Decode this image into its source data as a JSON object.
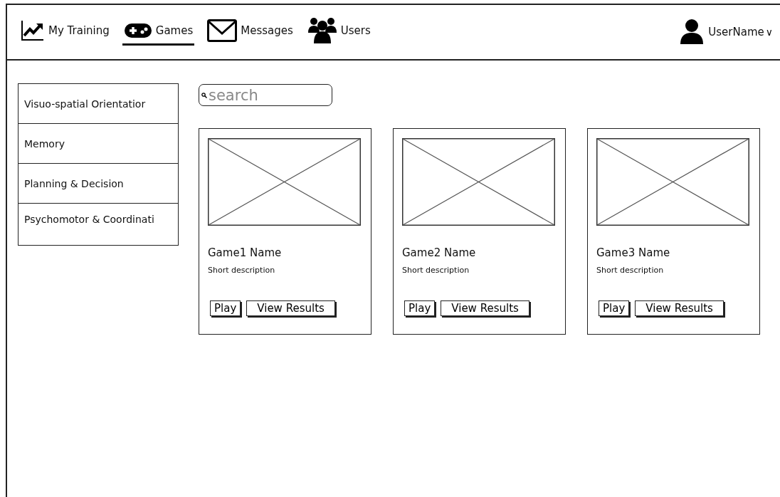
{
  "nav": [
    {
      "label": "My Training",
      "selected": false
    },
    {
      "label": "Games",
      "selected": true
    },
    {
      "label": "Messages",
      "selected": false
    },
    {
      "label": "Users",
      "selected": false
    }
  ],
  "user": {
    "name": "UserName",
    "caret": "∨"
  },
  "sidebar": {
    "items": [
      {
        "label": "Visuo-spatial Orientatior"
      },
      {
        "label": "Memory"
      },
      {
        "label": "Planning & Decision"
      },
      {
        "label": "Psychomotor & Coordinati"
      }
    ]
  },
  "search": {
    "placeholder": "search"
  },
  "games": [
    {
      "name": "Game1 Name",
      "description": "Short description",
      "buttons": [
        "Play",
        "View Results"
      ]
    },
    {
      "name": "Game2 Name",
      "description": "Short description",
      "buttons": [
        "Play",
        "View Results"
      ]
    },
    {
      "name": "Game3 Name",
      "description": "Short description",
      "buttons": [
        "Play",
        "View Results"
      ]
    }
  ]
}
